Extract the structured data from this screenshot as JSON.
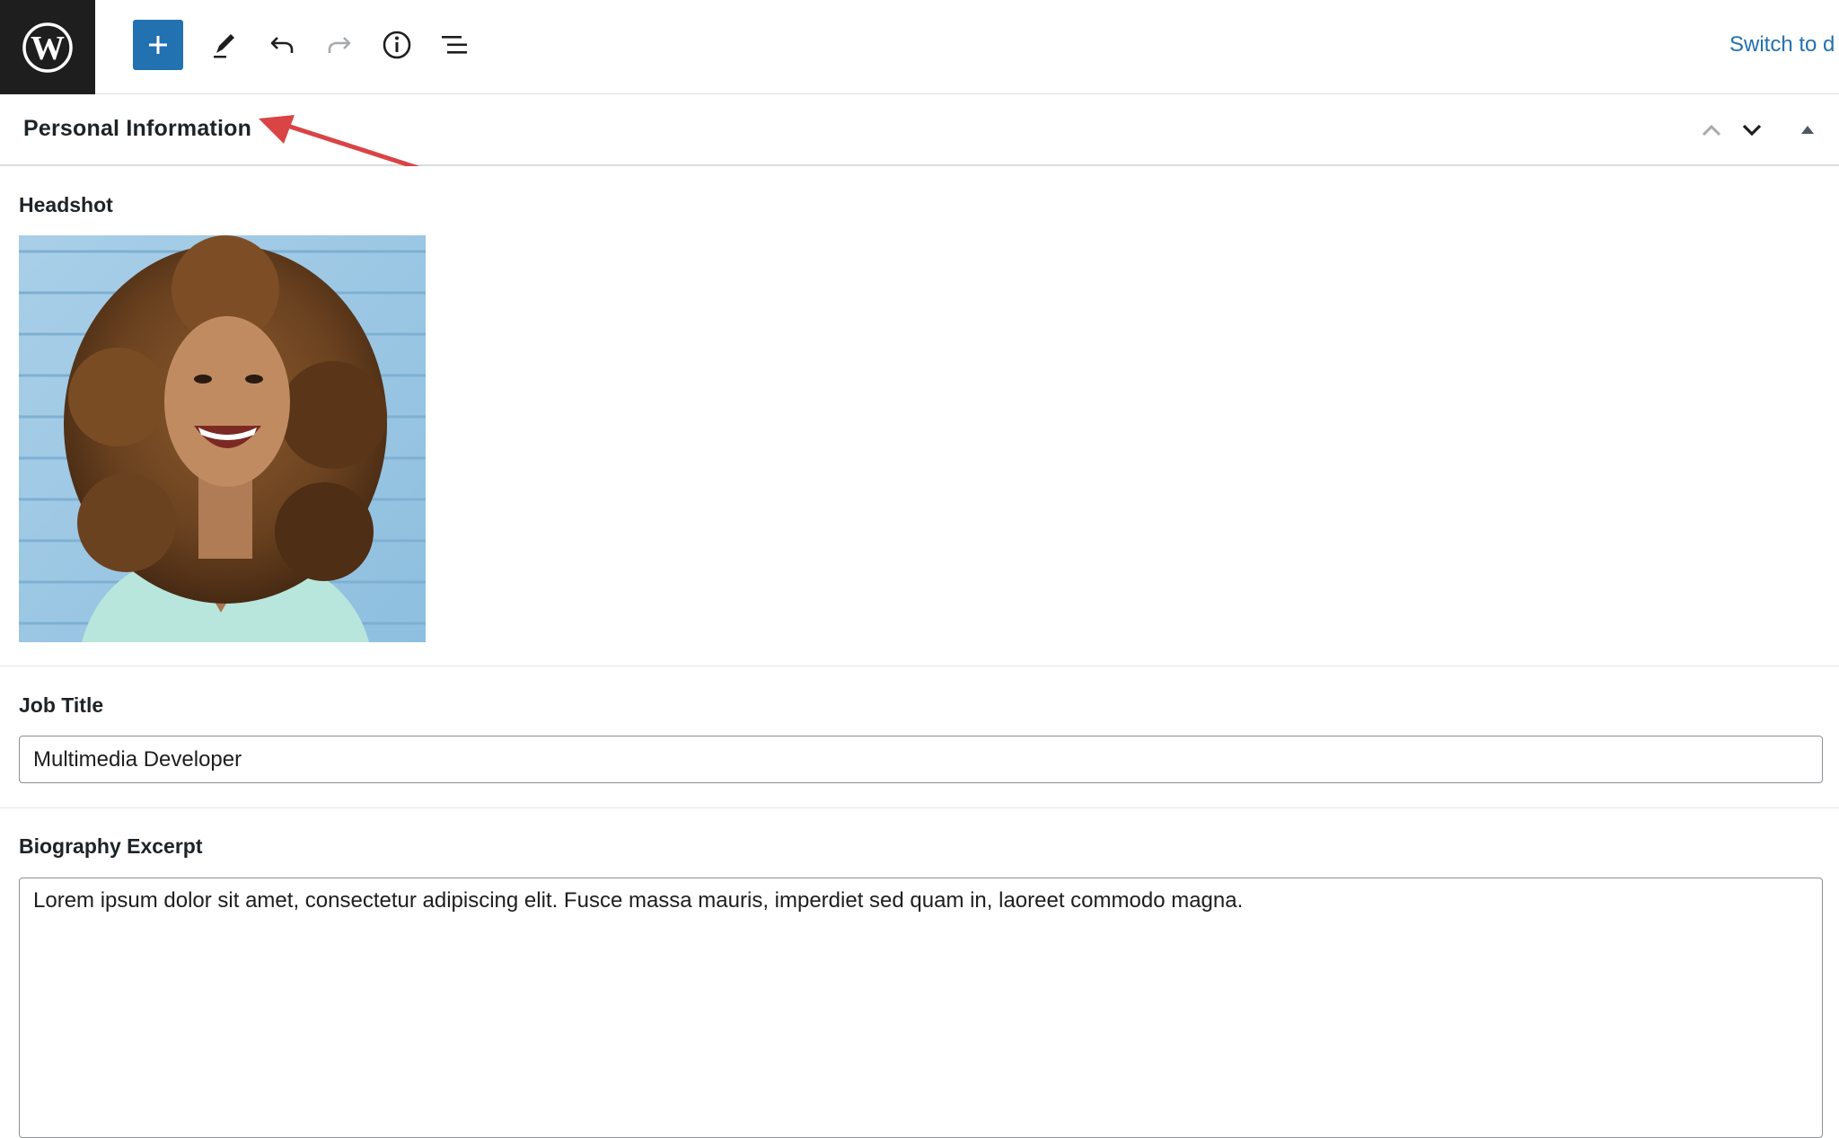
{
  "toolbar": {
    "logo_icon": "wordpress-logo-icon",
    "add_block_icon": "plus-icon",
    "tools_icon": "pencil-icon",
    "undo_icon": "undo-icon",
    "redo_icon": "redo-icon",
    "details_icon": "info-icon",
    "list_view_icon": "list-view-icon",
    "switch_link": "Switch to d",
    "accent_color": "#2271b1"
  },
  "panel": {
    "title": "Personal Information",
    "move_up_icon": "chevron-up-icon",
    "move_down_icon": "chevron-down-icon",
    "toggle_icon": "caret-up-icon"
  },
  "annotation": {
    "color": "#d94444"
  },
  "fields": {
    "headshot": {
      "label": "Headshot"
    },
    "job_title": {
      "label": "Job Title",
      "value": "Multimedia Developer"
    },
    "biography": {
      "label": "Biography Excerpt",
      "value": "Lorem ipsum dolor sit amet, consectetur adipiscing elit. Fusce massa mauris, imperdiet sed quam in, laoreet commodo magna."
    }
  }
}
